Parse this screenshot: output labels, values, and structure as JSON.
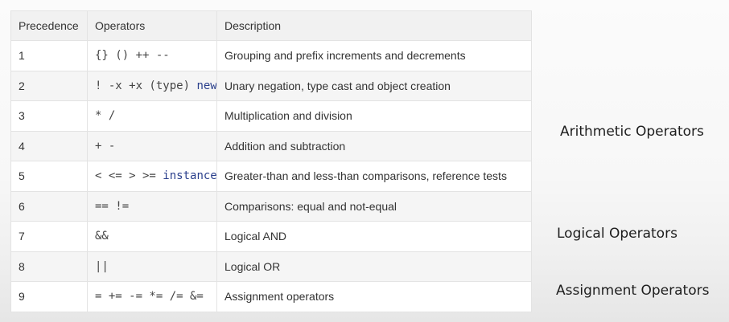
{
  "table": {
    "headers": [
      "Precedence",
      "Operators",
      "Description"
    ],
    "rows": [
      {
        "precedence": "1",
        "operators": "{} () ++ --",
        "keyword": "",
        "description": "Grouping and prefix increments and decrements"
      },
      {
        "precedence": "2",
        "operators": "! -x +x (type) ",
        "keyword": "new",
        "description": "Unary negation, type cast and object creation"
      },
      {
        "precedence": "3",
        "operators": "* /",
        "keyword": "",
        "description": "Multiplication and division"
      },
      {
        "precedence": "4",
        "operators": "+ -",
        "keyword": "",
        "description": "Addition and subtraction"
      },
      {
        "precedence": "5",
        "operators": "< <= > >= ",
        "keyword": "instanceof",
        "description": "Greater-than and less-than comparisons, reference tests"
      },
      {
        "precedence": "6",
        "operators": "== !=",
        "keyword": "",
        "description": "Comparisons: equal and not-equal"
      },
      {
        "precedence": "7",
        "operators": "&&",
        "keyword": "",
        "description": "Logical AND"
      },
      {
        "precedence": "8",
        "operators": "||",
        "keyword": "",
        "description": "Logical OR"
      },
      {
        "precedence": "9",
        "operators": "= += -= *= /= &=",
        "keyword": "",
        "description": "Assignment operators"
      }
    ]
  },
  "categories": {
    "arithmetic": "Arithmetic Operators",
    "logical": "Logical Operators",
    "assignment": "Assignment Operators"
  }
}
